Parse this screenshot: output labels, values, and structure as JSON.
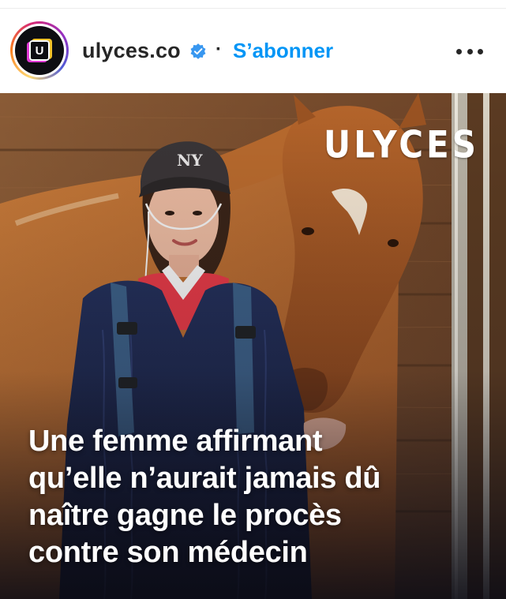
{
  "post": {
    "account": {
      "username": "ulyces.co",
      "avatar_letter": "U",
      "verified_icon": "verified-badge-icon",
      "separator": "·",
      "follow_label": "S’abonner",
      "more_icon": "more-horizontal-icon"
    },
    "image": {
      "brand_watermark": "ULYCES",
      "headline": "Une femme affirmant\nqu’elle n’aurait jamais dû\nnaître gagne le procès\ncontre son médecin"
    },
    "colors": {
      "link_blue": "#0095f6",
      "text_dark": "#262626",
      "verified_blue": "#3897f0"
    }
  }
}
